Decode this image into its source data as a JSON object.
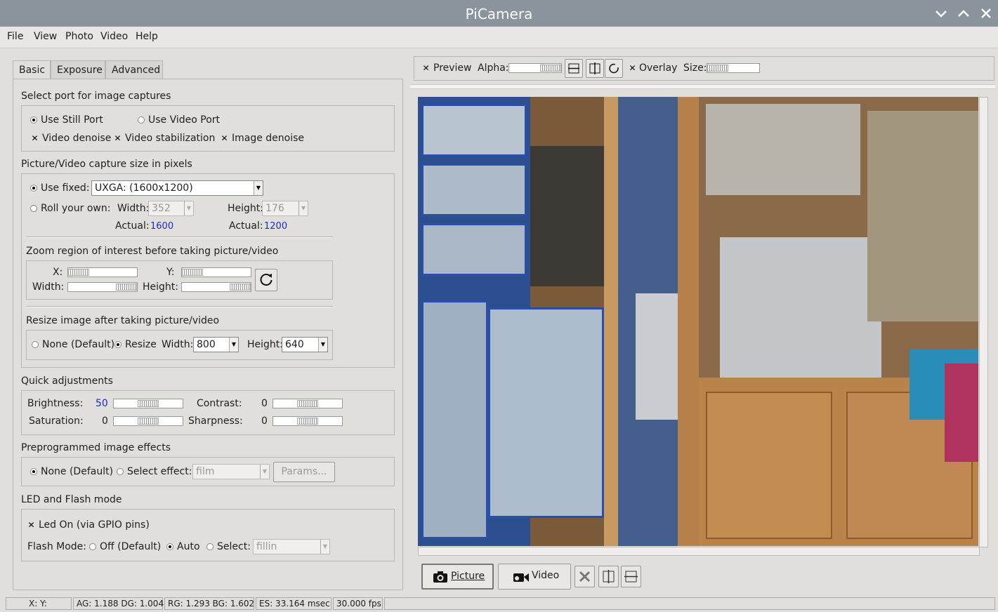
{
  "window": {
    "title": "PiCamera"
  },
  "menu": [
    "File",
    "View",
    "Photo",
    "Video",
    "Help"
  ],
  "tabs": [
    "Basic",
    "Exposure",
    "Advanced"
  ],
  "port": {
    "heading": "Select port for image captures",
    "still": "Use Still Port",
    "video": "Use Video Port",
    "denoise": "Video denoise",
    "stabilization": "Video stabilization",
    "image_denoise": "Image denoise"
  },
  "capture": {
    "heading": "Picture/Video capture size in pixels",
    "use_fixed": "Use fixed:",
    "fixed_value": "UXGA: (1600x1200)",
    "roll_own": "Roll your own:",
    "width_label": "Width:",
    "width_value": "352",
    "height_label": "Height:",
    "height_value": "176",
    "actual_label": "Actual:",
    "actual_w": "1600",
    "actual_h": "1200"
  },
  "zoom": {
    "heading": "Zoom region of interest before taking picture/video",
    "x_label": "X:",
    "y_label": "Y:",
    "width_label": "Width:",
    "height_label": "Height:"
  },
  "resize": {
    "heading": "Resize image after taking picture/video",
    "none": "None (Default)",
    "resize": "Resize",
    "width_label": "Width:",
    "width_value": "800",
    "height_label": "Height:",
    "height_value": "640"
  },
  "quick": {
    "heading": "Quick adjustments",
    "brightness_label": "Brightness:",
    "brightness_value": "50",
    "contrast_label": "Contrast:",
    "contrast_value": "0",
    "saturation_label": "Saturation:",
    "saturation_value": "0",
    "sharpness_label": "Sharpness:",
    "sharpness_value": "0"
  },
  "effects": {
    "heading": "Preprogrammed image effects",
    "none": "None (Default)",
    "select": "Select effect:",
    "effect_value": "film",
    "params": "Params..."
  },
  "led": {
    "heading": "LED and Flash mode",
    "led_on": "Led On (via GPIO pins)",
    "flash_label": "Flash Mode:",
    "off": "Off (Default)",
    "auto": "Auto",
    "select": "Select:",
    "select_value": "fillin"
  },
  "preview_bar": {
    "preview": "Preview",
    "alpha": "Alpha:",
    "overlay": "Overlay",
    "size": "Size:"
  },
  "actions": {
    "picture": "Picture",
    "video": "Video"
  },
  "status": {
    "xy": "X:  Y:",
    "gains": "AG: 1.188 DG: 1.004",
    "balance": "RG: 1.293 BG: 1.602",
    "exposure": "ES: 33.164 msec",
    "fps": "30.000 fps"
  },
  "icons": [
    "minimize-icon",
    "maximize-icon",
    "close-icon",
    "reset-icon",
    "camera-icon",
    "video-camera-icon"
  ]
}
